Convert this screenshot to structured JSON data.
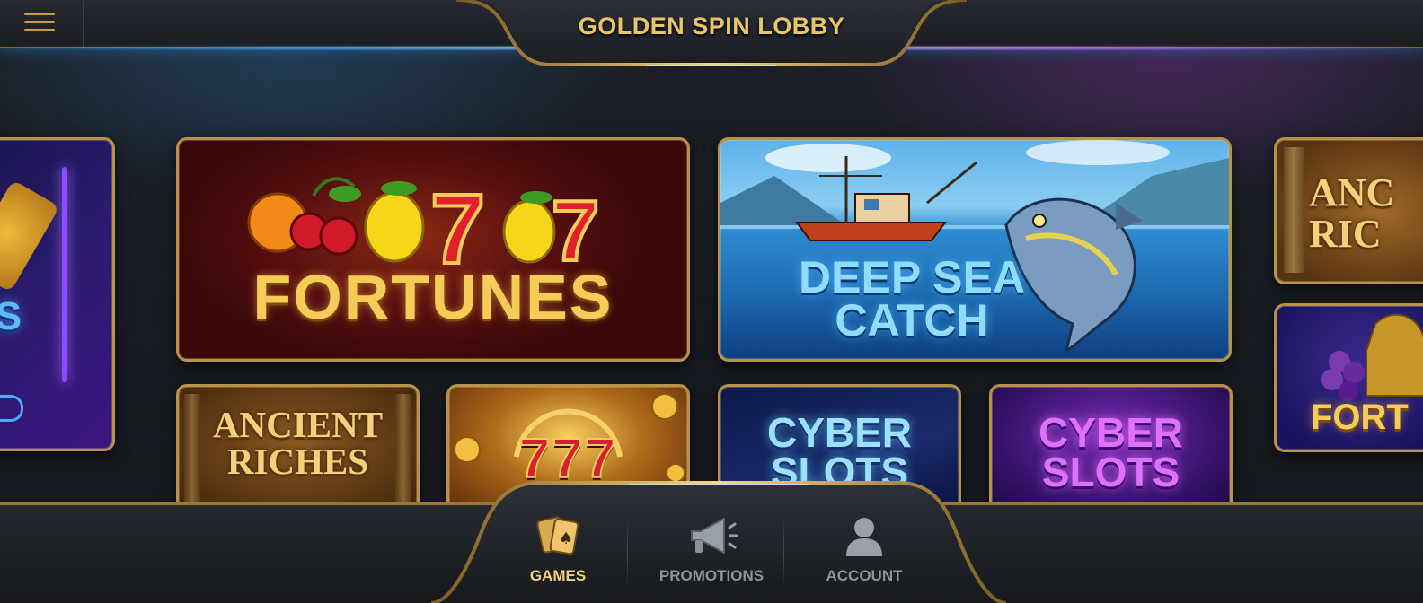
{
  "app": {
    "title": "GOLDEN SPIN LOBBY"
  },
  "colors": {
    "accent_gold": "#c9a24e",
    "glow_blue": "#3b9af0",
    "glow_purple": "#c770ff",
    "nav_active": "#f1d07a",
    "nav_inactive": "#8e949d"
  },
  "games": {
    "neon_partial": {
      "title": "DS"
    },
    "fortunes": {
      "title": "FORTUNES"
    },
    "deep_sea": {
      "title": "DEEP SEA\nCATCH"
    },
    "ancient_right": {
      "title": "ANC\nRIC"
    },
    "ancient_riches": {
      "title": "ANCIENT\nRICHES"
    },
    "triple_seven": {
      "title": "777"
    },
    "cyber_blue": {
      "title": "CYBER\nSLOTS"
    },
    "cyber_purple": {
      "title": "CYBER\nSLOTS"
    },
    "fortunes_right": {
      "title": "FORT"
    }
  },
  "nav": {
    "items": [
      {
        "label": "GAMES",
        "icon": "cards-icon",
        "active": true
      },
      {
        "label": "PROMOTIONS",
        "icon": "megaphone-icon",
        "active": false
      },
      {
        "label": "ACCOUNT",
        "icon": "user-icon",
        "active": false
      }
    ]
  }
}
